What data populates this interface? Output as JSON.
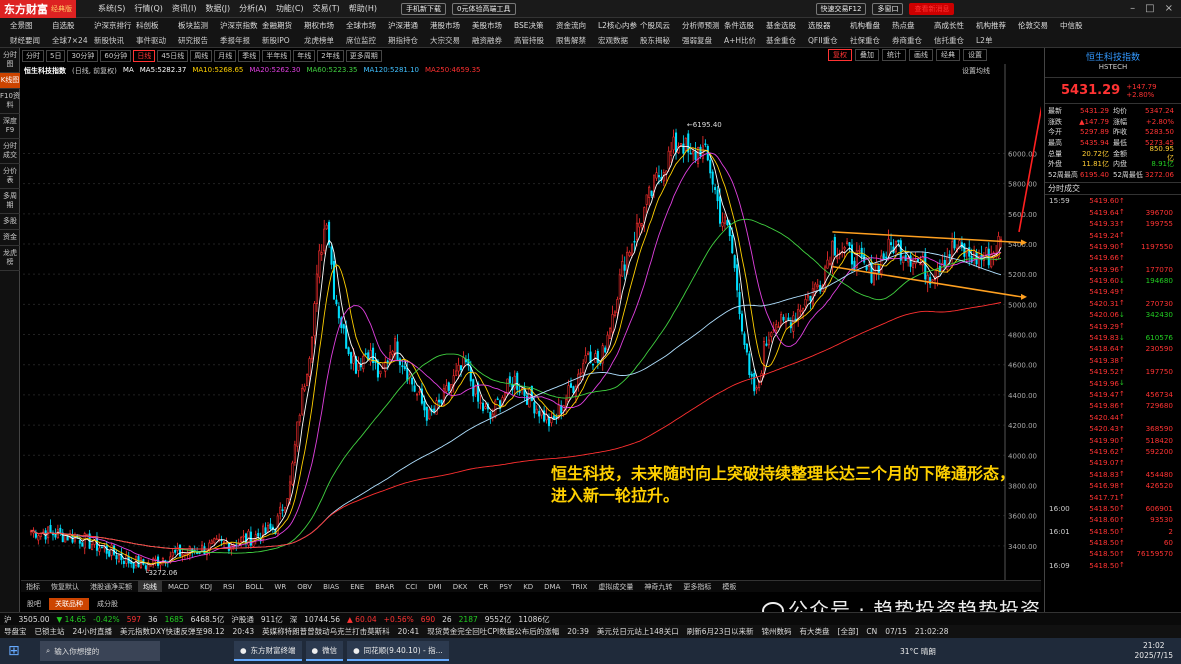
{
  "app": {
    "name": "东方财富",
    "edition": "经典版",
    "menus": [
      "系统(S)",
      "行情(Q)",
      "资讯(I)",
      "数据(J)",
      "分析(A)",
      "功能(C)",
      "交易(T)",
      "帮助(H)"
    ],
    "mobile_btn": "手机新下载",
    "promo": "0元体验高端工具",
    "quick_trade": "快速交易F12",
    "multi_window": "多窗口",
    "news_btn": "查看新消息",
    "red_btn": "查看新消息"
  },
  "nav": {
    "row1": [
      "全景图",
      "自选股",
      "沪深京排行",
      "科创板",
      "板块监测",
      "沪深京指数",
      "金融期货",
      "期权市场",
      "全球市场",
      "沪深港通",
      "港股市场",
      "美股市场",
      "BSE决策",
      "资金流向",
      "L2核心内参",
      "个股风云",
      "分析师预测",
      "条件选股",
      "基金选股",
      "选股器",
      "机构看盘",
      "热点盘",
      "高成长性",
      "机构推荐",
      "伦敦交易",
      "中信股"
    ],
    "row2": [
      "财经要闻",
      "全球7×24",
      "新股快讯",
      "事件驱动",
      "研究报告",
      "季报年报",
      "新股IPO",
      "龙虎榜单",
      "席位监控",
      "期指持仓",
      "大宗交易",
      "融资融券",
      "高管持股",
      "限售解禁",
      "宏观数据",
      "股东揭秘",
      "强弱复盘",
      "A+H比价",
      "基金重仓",
      "QFII重仓",
      "社保重仓",
      "券商重仓",
      "信托重仓",
      "L2单"
    ]
  },
  "left_tabs": [
    "分时图",
    "K线图",
    "F10资料",
    "深度F9",
    "分时成交",
    "分价表",
    "多周期",
    "多股",
    "资金",
    "龙虎榜"
  ],
  "period_tabs": [
    "分时",
    "5日",
    "30分钟",
    "60分钟",
    "日线",
    "45日线",
    "周线",
    "月线",
    "季线",
    "半年线",
    "年线",
    "2年线",
    "更多周期"
  ],
  "active_period": "日线",
  "right_tools": [
    "复权",
    "叠加",
    "统计",
    "画线",
    "经典",
    "设置"
  ],
  "active_tool": "复权",
  "chart_title": "恒生科技指数",
  "chart_subtitle": "(日线, 前复权)",
  "ma_legend": [
    {
      "text": "MA",
      "color": "#ffffff"
    },
    {
      "text": "MA5:5282.37",
      "color": "#ffffff"
    },
    {
      "text": "MA10:5268.65",
      "color": "#ffd000"
    },
    {
      "text": "MA20:5262.30",
      "color": "#e040e0"
    },
    {
      "text": "MA60:5223.35",
      "color": "#40d040"
    },
    {
      "text": "MA120:5281.10",
      "color": "#40c0ff"
    },
    {
      "text": "MA250:4659.35",
      "color": "#ff3030"
    }
  ],
  "quick_settings": "设置均线",
  "chart_data": {
    "type": "candlestick",
    "title": "恒生科技指数",
    "ylim": [
      3200,
      6500
    ],
    "yticks": [
      3400,
      3600,
      3800,
      4000,
      4200,
      4400,
      4600,
      4800,
      5000,
      5200,
      5400,
      5600,
      5800,
      6000
    ],
    "high_label": "6195.40",
    "low_label": "3272.06",
    "ohlc_summary": {
      "start": 3500,
      "low": 3272.06,
      "high": 6195.4,
      "last": 5431.29
    }
  },
  "annotation": "恒生科技，未来随时向上突破持续整理长达三个月的下降通形态，进入新一轮拉升。",
  "indicator_tabs": [
    "指标",
    "恢复默认",
    "港股通净买额",
    "均线",
    "MACD",
    "KDJ",
    "RSI",
    "BOLL",
    "WR",
    "OBV",
    "BIAS",
    "ENE",
    "BRAR",
    "CCI",
    "DMI",
    "DKX",
    "CR",
    "PSY",
    "KD",
    "DMA",
    "TRIX",
    "虚拟成交量",
    "神奇九转",
    "更多指标",
    "模板"
  ],
  "active_indicator": "均线",
  "sub_tabs": [
    "股吧",
    "关联品种",
    "成分股"
  ],
  "active_sub_tab": "关联品种",
  "quote": {
    "name": "恒生科技指数",
    "code": "HSTECH",
    "price": "5431.29",
    "change": "+147.79",
    "pct": "+2.80%",
    "stats": [
      [
        "最新",
        "5431.29",
        "均价",
        "5347.24"
      ],
      [
        "涨跌",
        "▲147.79",
        "涨幅",
        "+2.80%"
      ],
      [
        "今开",
        "5297.89",
        "昨收",
        "5283.50"
      ],
      [
        "最高",
        "5435.94",
        "最低",
        "5273.45"
      ],
      [
        "总量",
        "20.72亿",
        "金额",
        "850.95亿"
      ],
      [
        "外盘",
        "11.81亿",
        "内盘",
        "8.91亿"
      ],
      [
        "52周最高",
        "6195.40",
        "52周最低",
        "3272.06"
      ]
    ],
    "trade_header": "分时成交",
    "trades": [
      [
        "15:59",
        "5419.60",
        "↑",
        ""
      ],
      [
        "",
        "5419.64",
        "↑",
        "396700"
      ],
      [
        "",
        "5419.33",
        "↑",
        "199755"
      ],
      [
        "",
        "5419.24",
        "↑",
        ""
      ],
      [
        "",
        "5419.90",
        "↑",
        "1197550"
      ],
      [
        "",
        "5419.66",
        "↑",
        ""
      ],
      [
        "",
        "5419.96",
        "↑",
        "177070"
      ],
      [
        "",
        "5419.60",
        "↓",
        "194680"
      ],
      [
        "",
        "5419.49",
        "↑",
        ""
      ],
      [
        "",
        "5420.31",
        "↑",
        "270730"
      ],
      [
        "",
        "5420.06",
        "↓",
        "342430"
      ],
      [
        "",
        "5419.29",
        "↑",
        ""
      ],
      [
        "",
        "5419.83",
        "↓",
        "610576"
      ],
      [
        "",
        "5418.64",
        "↑",
        "230590"
      ],
      [
        "",
        "5419.38",
        "↑",
        ""
      ],
      [
        "",
        "5419.52",
        "↑",
        "197750"
      ],
      [
        "",
        "5419.96",
        "↓",
        ""
      ],
      [
        "",
        "5419.47",
        "↑",
        "456734"
      ],
      [
        "",
        "5419.86",
        "↑",
        "729680"
      ],
      [
        "",
        "5420.44",
        "↑",
        ""
      ],
      [
        "",
        "5420.43",
        "↑",
        "368590"
      ],
      [
        "",
        "5419.90",
        "↑",
        "518420"
      ],
      [
        "",
        "5419.62",
        "↑",
        "592200"
      ],
      [
        "",
        "5419.07",
        "↑",
        ""
      ],
      [
        "",
        "5418.83",
        "↑",
        "454480"
      ],
      [
        "",
        "5416.98",
        "↑",
        "426520"
      ],
      [
        "",
        "5417.71",
        "↑",
        ""
      ],
      [
        "16:00",
        "5418.50",
        "↑",
        "606901"
      ],
      [
        "",
        "5418.60",
        "↑",
        "93530"
      ],
      [
        "16:01",
        "5418.50",
        "↑",
        "2"
      ],
      [
        "",
        "5418.50",
        "↑",
        "60"
      ],
      [
        "",
        "5418.50",
        "↑",
        "76159570"
      ],
      [
        "16:09",
        "5418.50",
        "↑",
        ""
      ]
    ]
  },
  "ticker": [
    {
      "t": "沪",
      "c": "#ddd"
    },
    {
      "t": "3505.00",
      "c": "#ddd"
    },
    {
      "t": "▼ 14.65",
      "c": "#2c2"
    },
    {
      "t": "-0.42%",
      "c": "#2c2"
    },
    {
      "t": "597",
      "c": "#f33"
    },
    {
      "t": "36",
      "c": "#ddd"
    },
    {
      "t": "1685",
      "c": "#2c2"
    },
    {
      "t": "6468.5亿",
      "c": "#ddd"
    },
    {
      "t": "沪股通",
      "c": "#ddd"
    },
    {
      "t": "911亿",
      "c": "#ddd"
    },
    {
      "t": "深",
      "c": "#ddd"
    },
    {
      "t": "10744.56",
      "c": "#ddd"
    },
    {
      "t": "▲ 60.04",
      "c": "#f33"
    },
    {
      "t": "+0.56%",
      "c": "#f33"
    },
    {
      "t": "690",
      "c": "#f33"
    },
    {
      "t": "26",
      "c": "#ddd"
    },
    {
      "t": "2187",
      "c": "#2c2"
    },
    {
      "t": "9552亿",
      "c": "#ddd"
    },
    {
      "t": "11086亿",
      "c": "#ddd"
    }
  ],
  "news": [
    "导盘宝",
    "已锁主站",
    "24小时直播",
    "美元指数DXY快速反弹至98.12",
    "20:43",
    "英媒称特朗普曾鼓动乌克兰打击莫斯科",
    "20:41",
    "现货黄金完全回吐CPI数据公布后的涨幅",
    "20:39",
    "美元兑日元站上148关口",
    "刷新6月23日以来新",
    "锦州数码",
    "有大类盘",
    "[全部]",
    "CN",
    "07/15",
    "21:02:28"
  ],
  "taskbar": {
    "search": "输入你想搜的",
    "apps": [
      "东方财富终端",
      "微信",
      "同花顺(9.40.10) - 指..."
    ],
    "weather": "31°C 晴朗",
    "time": "21:02",
    "date": "2025/7/15"
  },
  "watermark": "公众号 · 趋势投资趋势投资"
}
